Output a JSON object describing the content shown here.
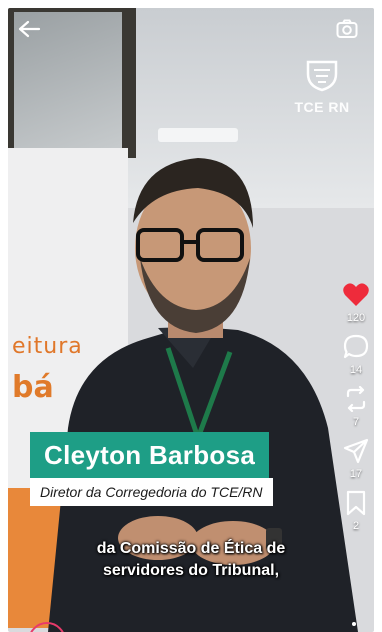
{
  "overlay": {
    "logo_text": "TCE RN"
  },
  "actions": {
    "like": {
      "count": "120"
    },
    "comment": {
      "count": "14"
    },
    "repost": {
      "count": "7"
    },
    "share": {
      "count": "17"
    },
    "save": {
      "count": "2"
    }
  },
  "lower_third": {
    "name": "Cleyton Barbosa",
    "role": "Diretor da Corregedoria do TCE/RN"
  },
  "subtitle": {
    "line1": "da Comissão de Ética de",
    "line2": "servidores do Tribunal,"
  },
  "scene": {
    "banner_text_1": "eitura",
    "banner_text_2": "bá"
  },
  "colors": {
    "like_red": "#ee2b3b",
    "name_teal": "#1e9e86"
  }
}
